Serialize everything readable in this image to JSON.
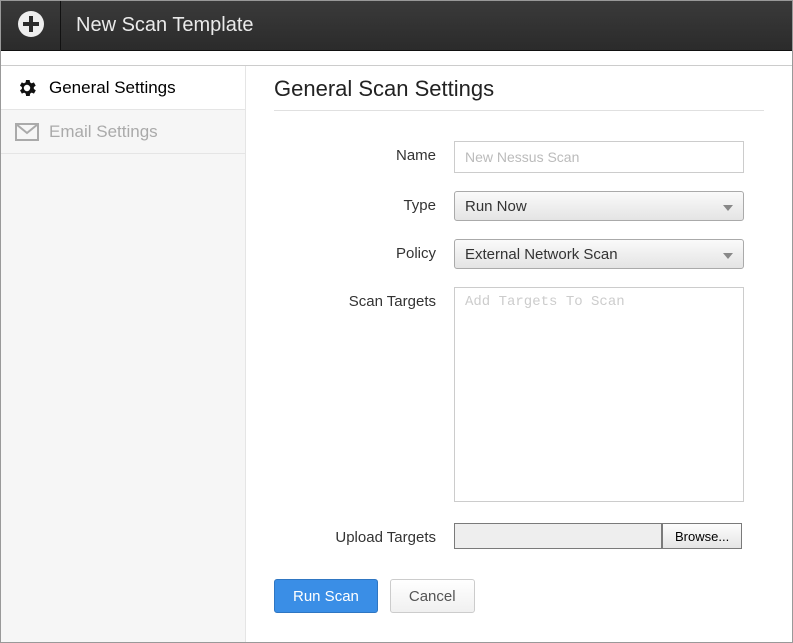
{
  "header": {
    "title": "New Scan Template"
  },
  "sidebar": {
    "items": [
      {
        "label": "General Settings",
        "icon": "gear-icon",
        "active": true
      },
      {
        "label": "Email Settings",
        "icon": "mail-icon",
        "active": false
      }
    ]
  },
  "main": {
    "heading": "General Scan Settings",
    "fields": {
      "name": {
        "label": "Name",
        "value": "",
        "placeholder": "New Nessus Scan"
      },
      "type": {
        "label": "Type",
        "selected": "Run Now"
      },
      "policy": {
        "label": "Policy",
        "selected": "External Network Scan"
      },
      "targets": {
        "label": "Scan Targets",
        "value": "",
        "placeholder": "Add Targets To Scan"
      },
      "upload": {
        "label": "Upload Targets",
        "value": "",
        "browse_label": "Browse..."
      }
    },
    "actions": {
      "primary": "Run Scan",
      "secondary": "Cancel"
    }
  }
}
